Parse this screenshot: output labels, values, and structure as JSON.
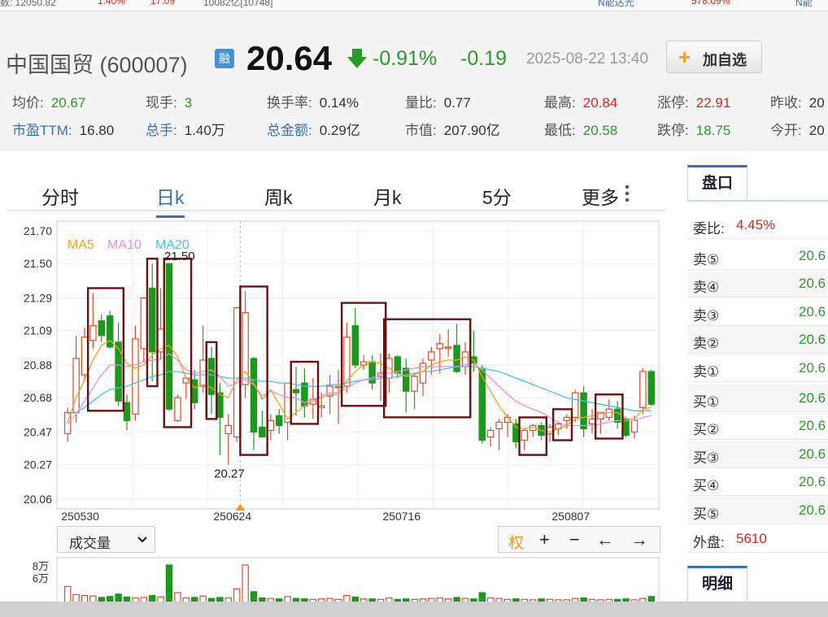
{
  "ticker": [
    "数: 12050.82",
    "1.40%",
    "17.09",
    "10082亿[10748]",
    "N能达光",
    "578.09%",
    "N能"
  ],
  "stock": {
    "name": "中国国贸 (600007)",
    "rong": "融",
    "price": "20.64",
    "pct": "-0.91%",
    "change": "-0.19",
    "datetime": "2025-08-22 13:40",
    "add_label": "加自选",
    "add_icon": "plus-icon"
  },
  "quote": [
    {
      "label": "均价:",
      "value": "20.67",
      "style": "g"
    },
    {
      "label": "现手:",
      "value": "3",
      "style": "g"
    },
    {
      "label": "换手率:",
      "value": "0.14%",
      "style": "n"
    },
    {
      "label": "量比:",
      "value": "0.77",
      "style": "n"
    },
    {
      "label": "最高:",
      "value": "20.84",
      "style": "r"
    },
    {
      "label": "涨停:",
      "value": "22.91",
      "style": "r"
    },
    {
      "label": "昨收:",
      "value": "20",
      "style": "n"
    },
    {
      "label": "市盈TTM:",
      "value": "16.80",
      "style": "n",
      "link": true
    },
    {
      "label": "总手:",
      "value": "1.40万",
      "style": "n",
      "link": true
    },
    {
      "label": "总金额:",
      "value": "0.29亿",
      "style": "n",
      "link": true
    },
    {
      "label": "市值:",
      "value": "207.90亿",
      "style": "n"
    },
    {
      "label": "最低:",
      "value": "20.58",
      "style": "g"
    },
    {
      "label": "跌停:",
      "value": "18.75",
      "style": "g"
    },
    {
      "label": "今开:",
      "value": "20",
      "style": "n"
    }
  ],
  "tabs": [
    "分时",
    "日k",
    "周k",
    "月k",
    "5分",
    "更多"
  ],
  "active_tab": "日k",
  "more_icon": "vertical-dots-icon",
  "volume": {
    "selector_label": "成交量",
    "y_labels": [
      "8万",
      "6万"
    ]
  },
  "controls": {
    "quan": "权",
    "plus": "+",
    "minus": "−",
    "left": "←",
    "right": "→"
  },
  "side": {
    "tab1": "盘口",
    "tab2": "明细",
    "weibi_label": "委比:",
    "weibi_value": "4.45%",
    "rows": [
      {
        "k": "卖⑤",
        "v": "20.6"
      },
      {
        "k": "卖④",
        "v": "20.6"
      },
      {
        "k": "卖③",
        "v": "20.6"
      },
      {
        "k": "卖②",
        "v": "20.6"
      },
      {
        "k": "卖①",
        "v": "20.6"
      },
      {
        "k": "买①",
        "v": "20.6"
      },
      {
        "k": "买②",
        "v": "20.6"
      },
      {
        "k": "买③",
        "v": "20.6"
      },
      {
        "k": "买④",
        "v": "20.6"
      },
      {
        "k": "买⑤",
        "v": "20.6"
      }
    ],
    "waipan_label": "外盘:",
    "waipan_value": "5610"
  },
  "colors": {
    "up": "#e8482a",
    "down": "#1a9a1a",
    "ma5": "#f0a020",
    "ma10": "#e58ee5",
    "ma20": "#3ec7df",
    "box": "#6b1010",
    "marker": "#f29a1d"
  },
  "chart_data": {
    "type": "candlestick",
    "yticks": [
      "21.70",
      "21.50",
      "21.29",
      "21.09",
      "20.88",
      "20.68",
      "20.47",
      "20.27",
      "20.06"
    ],
    "ylim": [
      20.06,
      21.7
    ],
    "xticks": [
      {
        "label": "250530",
        "index": 0
      },
      {
        "label": "250624",
        "index": 18
      },
      {
        "label": "250716",
        "index": 38
      },
      {
        "label": "250807",
        "index": 58
      }
    ],
    "legend": [
      "MA5",
      "MA10",
      "MA20"
    ],
    "annotations": [
      {
        "text": "21.50",
        "index": 12
      },
      {
        "text": "20.27",
        "index": 20
      }
    ],
    "candles": [
      {
        "o": 20.46,
        "h": 20.62,
        "l": 20.41,
        "c": 20.59
      },
      {
        "o": 20.59,
        "h": 21.06,
        "l": 20.53,
        "c": 20.92
      },
      {
        "o": 20.82,
        "h": 21.11,
        "l": 20.78,
        "c": 21.05
      },
      {
        "o": 21.03,
        "h": 21.32,
        "l": 20.98,
        "c": 21.12
      },
      {
        "o": 21.15,
        "h": 21.19,
        "l": 21.02,
        "c": 21.06
      },
      {
        "o": 21.18,
        "h": 21.21,
        "l": 20.98,
        "c": 20.99
      },
      {
        "o": 21.02,
        "h": 21.14,
        "l": 20.63,
        "c": 20.66
      },
      {
        "o": 20.65,
        "h": 20.7,
        "l": 20.48,
        "c": 20.54
      },
      {
        "o": 20.58,
        "h": 21.12,
        "l": 20.54,
        "c": 21.04
      },
      {
        "o": 20.98,
        "h": 21.29,
        "l": 20.9,
        "c": 21.29
      },
      {
        "o": 21.35,
        "h": 21.5,
        "l": 20.78,
        "c": 20.96
      },
      {
        "o": 20.96,
        "h": 21.35,
        "l": 20.91,
        "c": 21.1
      },
      {
        "o": 21.5,
        "h": 21.5,
        "l": 20.6,
        "c": 20.61
      },
      {
        "o": 20.54,
        "h": 20.7,
        "l": 20.53,
        "c": 20.68
      },
      {
        "o": 20.77,
        "h": 20.8,
        "l": 20.67,
        "c": 20.8
      },
      {
        "o": 20.79,
        "h": 20.85,
        "l": 20.61,
        "c": 20.65
      },
      {
        "o": 20.75,
        "h": 21.12,
        "l": 20.71,
        "c": 20.91
      },
      {
        "o": 20.92,
        "h": 20.99,
        "l": 20.58,
        "c": 20.7
      },
      {
        "o": 20.71,
        "h": 20.77,
        "l": 20.33,
        "c": 20.56
      },
      {
        "o": 20.46,
        "h": 20.58,
        "l": 20.27,
        "c": 20.51
      },
      {
        "o": 20.44,
        "h": 20.89,
        "l": 20.41,
        "c": 21.23
      },
      {
        "o": 20.76,
        "h": 21.33,
        "l": 20.68,
        "c": 21.2
      },
      {
        "o": 20.92,
        "h": 20.93,
        "l": 20.36,
        "c": 20.47
      },
      {
        "o": 20.5,
        "h": 20.6,
        "l": 20.44,
        "c": 20.44
      },
      {
        "o": 20.48,
        "h": 20.58,
        "l": 20.42,
        "c": 20.54
      },
      {
        "o": 20.57,
        "h": 20.61,
        "l": 20.46,
        "c": 20.51
      },
      {
        "o": 20.53,
        "h": 20.77,
        "l": 20.42,
        "c": 20.77
      },
      {
        "o": 20.73,
        "h": 20.87,
        "l": 20.57,
        "c": 20.71
      },
      {
        "o": 20.77,
        "h": 20.86,
        "l": 20.56,
        "c": 20.63
      },
      {
        "o": 20.64,
        "h": 20.8,
        "l": 20.55,
        "c": 20.67
      },
      {
        "o": 20.62,
        "h": 20.71,
        "l": 20.56,
        "c": 20.63
      },
      {
        "o": 20.69,
        "h": 20.82,
        "l": 20.58,
        "c": 20.75
      },
      {
        "o": 20.75,
        "h": 20.85,
        "l": 20.52,
        "c": 20.75
      },
      {
        "o": 20.75,
        "h": 21.14,
        "l": 20.71,
        "c": 21.05
      },
      {
        "o": 21.12,
        "h": 21.23,
        "l": 20.86,
        "c": 20.88
      },
      {
        "o": 20.88,
        "h": 20.94,
        "l": 20.85,
        "c": 20.9
      },
      {
        "o": 20.9,
        "h": 20.94,
        "l": 20.73,
        "c": 20.77
      },
      {
        "o": 20.81,
        "h": 20.95,
        "l": 20.66,
        "c": 20.83
      },
      {
        "o": 20.8,
        "h": 20.95,
        "l": 20.71,
        "c": 20.92
      },
      {
        "o": 20.93,
        "h": 20.94,
        "l": 20.8,
        "c": 20.83
      },
      {
        "o": 20.86,
        "h": 20.92,
        "l": 20.59,
        "c": 20.72
      },
      {
        "o": 20.72,
        "h": 20.83,
        "l": 20.61,
        "c": 20.81
      },
      {
        "o": 20.77,
        "h": 20.92,
        "l": 20.69,
        "c": 20.89
      },
      {
        "o": 20.91,
        "h": 20.99,
        "l": 20.82,
        "c": 20.96
      },
      {
        "o": 20.98,
        "h": 21.07,
        "l": 20.83,
        "c": 21.01
      },
      {
        "o": 20.99,
        "h": 21.1,
        "l": 20.93,
        "c": 20.99
      },
      {
        "o": 21.0,
        "h": 21.13,
        "l": 20.83,
        "c": 20.84
      },
      {
        "o": 20.87,
        "h": 21.02,
        "l": 20.82,
        "c": 20.96
      },
      {
        "o": 20.93,
        "h": 21.09,
        "l": 20.84,
        "c": 20.89
      },
      {
        "o": 20.86,
        "h": 20.88,
        "l": 20.4,
        "c": 20.42
      },
      {
        "o": 20.44,
        "h": 20.5,
        "l": 20.38,
        "c": 20.48
      },
      {
        "o": 20.49,
        "h": 20.55,
        "l": 20.36,
        "c": 20.53
      },
      {
        "o": 20.53,
        "h": 20.58,
        "l": 20.44,
        "c": 20.56
      },
      {
        "o": 20.52,
        "h": 20.55,
        "l": 20.37,
        "c": 20.41
      },
      {
        "o": 20.42,
        "h": 20.49,
        "l": 20.36,
        "c": 20.48
      },
      {
        "o": 20.48,
        "h": 20.52,
        "l": 20.44,
        "c": 20.51
      },
      {
        "o": 20.51,
        "h": 20.53,
        "l": 20.42,
        "c": 20.45
      },
      {
        "o": 20.46,
        "h": 20.52,
        "l": 20.41,
        "c": 20.5
      },
      {
        "o": 20.49,
        "h": 20.53,
        "l": 20.45,
        "c": 20.52
      },
      {
        "o": 20.54,
        "h": 20.58,
        "l": 20.49,
        "c": 20.56
      },
      {
        "o": 20.56,
        "h": 20.73,
        "l": 20.53,
        "c": 20.71
      },
      {
        "o": 20.71,
        "h": 20.75,
        "l": 20.44,
        "c": 20.49
      },
      {
        "o": 20.52,
        "h": 20.61,
        "l": 20.46,
        "c": 20.55
      },
      {
        "o": 20.55,
        "h": 20.59,
        "l": 20.46,
        "c": 20.59
      },
      {
        "o": 20.56,
        "h": 20.67,
        "l": 20.54,
        "c": 20.61
      },
      {
        "o": 20.61,
        "h": 20.66,
        "l": 20.49,
        "c": 20.53
      },
      {
        "o": 20.55,
        "h": 20.56,
        "l": 20.44,
        "c": 20.45
      },
      {
        "o": 20.47,
        "h": 20.57,
        "l": 20.43,
        "c": 20.54
      },
      {
        "o": 20.62,
        "h": 20.86,
        "l": 20.58,
        "c": 20.84
      },
      {
        "o": 20.84,
        "h": 20.85,
        "l": 20.63,
        "c": 20.64
      }
    ],
    "ma5": [
      20.53,
      20.68,
      20.79,
      20.91,
      21.0,
      21.03,
      20.98,
      20.89,
      20.86,
      20.88,
      20.94,
      20.98,
      21.0,
      20.93,
      20.8,
      20.74,
      20.76,
      20.74,
      20.7,
      20.68,
      20.79,
      20.84,
      20.77,
      20.67,
      20.73,
      20.64,
      20.55,
      20.59,
      20.63,
      20.66,
      20.68,
      20.7,
      20.7,
      20.78,
      20.84,
      20.88,
      20.9,
      20.89,
      20.86,
      20.83,
      20.81,
      20.82,
      20.84,
      20.88,
      20.9,
      20.91,
      20.91,
      20.93,
      20.91,
      20.81,
      20.72,
      20.63,
      20.56,
      20.5,
      20.49,
      20.5,
      20.48,
      20.47,
      20.49,
      20.51,
      20.55,
      20.56,
      20.57,
      20.58,
      20.59,
      20.59,
      20.55,
      20.55,
      20.61,
      20.62
    ],
    "ma10": [
      20.52,
      20.58,
      20.66,
      20.74,
      20.82,
      20.88,
      20.88,
      20.87,
      20.88,
      20.9,
      20.91,
      20.92,
      20.95,
      20.91,
      20.85,
      20.83,
      20.84,
      20.85,
      20.81,
      20.75,
      20.77,
      20.79,
      20.76,
      20.69,
      20.72,
      20.7,
      20.68,
      20.68,
      20.65,
      20.67,
      20.69,
      20.71,
      20.71,
      20.74,
      20.77,
      20.79,
      20.8,
      20.82,
      20.83,
      20.84,
      20.85,
      20.86,
      20.87,
      20.87,
      20.87,
      20.87,
      20.87,
      20.88,
      20.89,
      20.85,
      20.8,
      20.75,
      20.7,
      20.66,
      20.63,
      20.61,
      20.59,
      20.56,
      20.53,
      20.51,
      20.51,
      20.51,
      20.51,
      20.52,
      20.53,
      20.54,
      20.54,
      20.54,
      20.56,
      20.57
    ],
    "ma20": [
      20.58,
      20.59,
      20.62,
      20.66,
      20.7,
      20.73,
      20.74,
      20.75,
      20.77,
      20.79,
      20.81,
      20.82,
      20.84,
      20.84,
      20.83,
      20.82,
      20.82,
      20.82,
      20.81,
      20.8,
      20.8,
      20.8,
      20.79,
      20.78,
      20.78,
      20.77,
      20.77,
      20.76,
      20.75,
      20.75,
      20.75,
      20.76,
      20.76,
      20.77,
      20.78,
      20.79,
      20.79,
      20.8,
      20.8,
      20.81,
      20.82,
      20.83,
      20.84,
      20.84,
      20.85,
      20.86,
      20.87,
      20.87,
      20.87,
      20.86,
      20.85,
      20.84,
      20.82,
      20.8,
      20.78,
      20.76,
      20.74,
      20.72,
      20.7,
      20.68,
      20.67,
      20.66,
      20.65,
      20.64,
      20.63,
      20.62,
      20.61,
      20.6,
      20.6,
      20.6
    ],
    "volume": [
      3.5,
      1.8,
      1.6,
      1.5,
      1.2,
      1.4,
      1.9,
      1.3,
      1.1,
      1.2,
      1.6,
      1.3,
      8.0,
      2.2,
      1.1,
      1.2,
      1.5,
      1.0,
      1.2,
      1.1,
      3.0,
      8.0,
      2.4,
      1.1,
      1.0,
      0.9,
      1.4,
      1.0,
      0.9,
      0.8,
      0.9,
      1.0,
      0.8,
      1.6,
      1.3,
      0.9,
      0.9,
      0.8,
      1.1,
      0.8,
      0.9,
      0.8,
      0.9,
      1.0,
      1.1,
      0.9,
      1.2,
      1.0,
      0.9,
      2.2,
      1.1,
      1.0,
      0.8,
      0.9,
      0.8,
      0.7,
      0.9,
      0.8,
      0.7,
      0.7,
      1.0,
      1.1,
      0.8,
      0.7,
      0.8,
      0.8,
      0.9,
      0.7,
      1.0,
      1.4
    ],
    "highlight_ranges": [
      [
        3,
        6
      ],
      [
        10,
        10
      ],
      [
        12,
        14
      ],
      [
        17,
        17
      ],
      [
        21,
        23
      ],
      [
        27,
        29
      ],
      [
        33,
        37
      ],
      [
        38,
        47
      ],
      [
        54,
        56
      ],
      [
        58,
        59
      ],
      [
        63,
        65
      ]
    ]
  }
}
